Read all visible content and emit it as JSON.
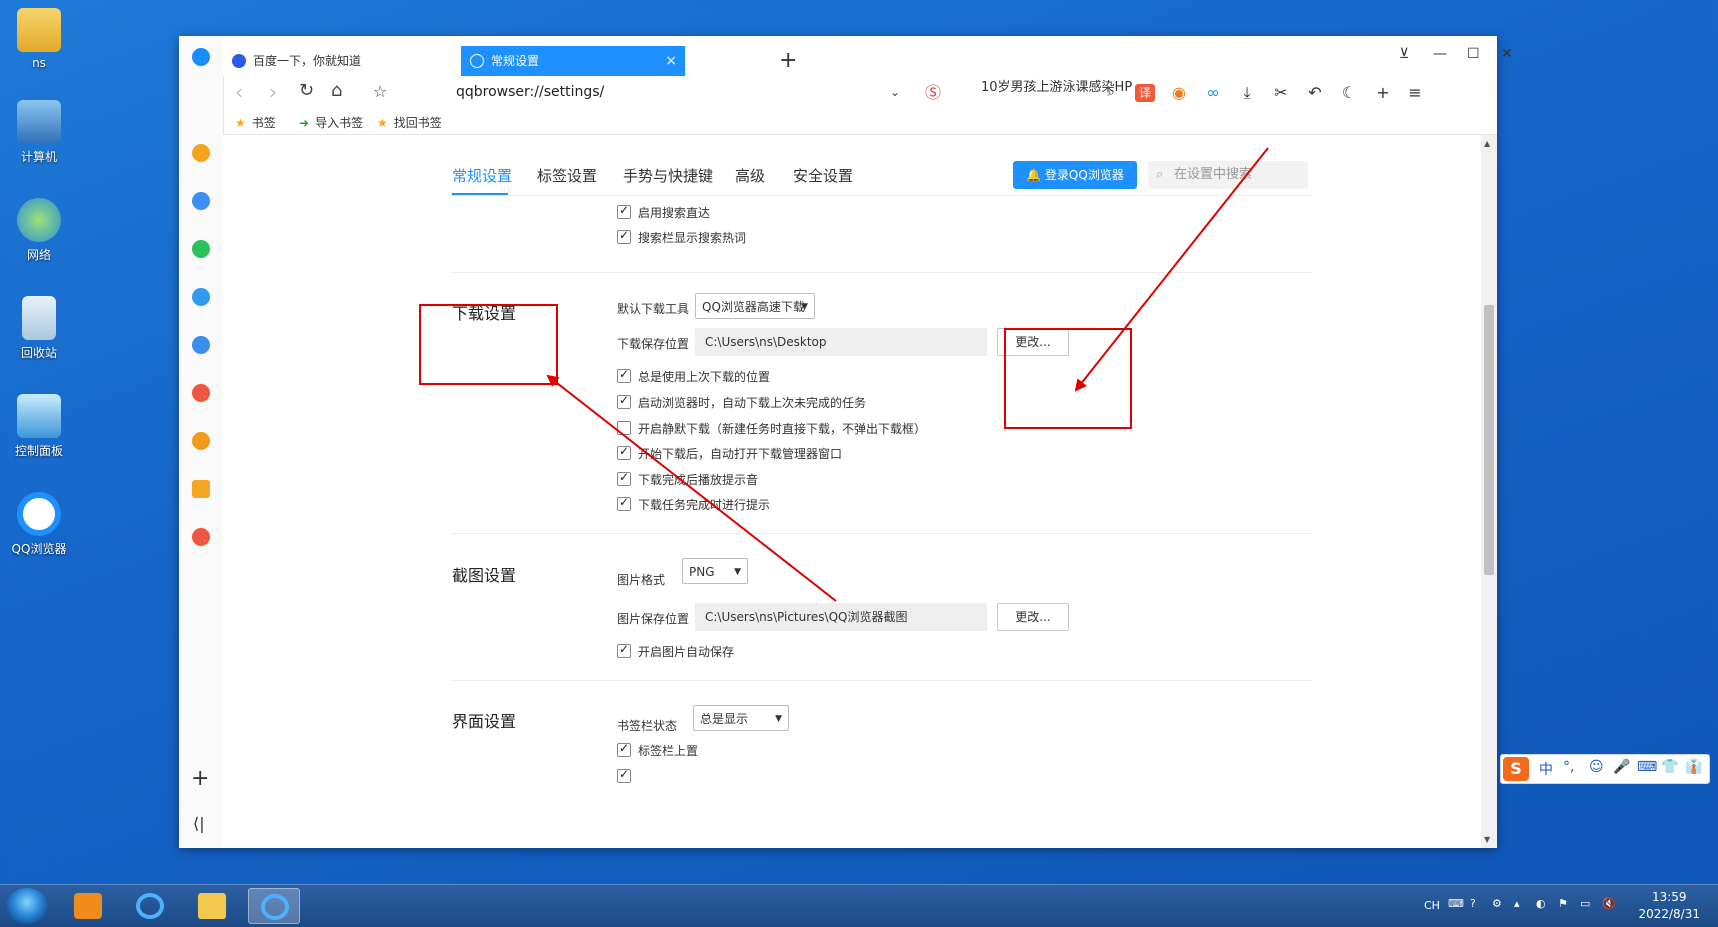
{
  "desktop": {
    "icons": [
      {
        "label": "ns",
        "color": "#f0c04a"
      },
      {
        "label": "计算机",
        "color": "#4b8fd6"
      },
      {
        "label": "网络",
        "color": "#3d9be0"
      },
      {
        "label": "回收站",
        "color": "#cfe3f2"
      },
      {
        "label": "控制面板",
        "color": "#5ab0e8"
      },
      {
        "label": "QQ浏览器",
        "color": "#1e90ff"
      }
    ]
  },
  "browser": {
    "tabs": [
      {
        "title": "百度一下，你就知道",
        "close": ""
      },
      {
        "title": "常规设置",
        "close": "×"
      }
    ],
    "new_tab": "+",
    "window_controls": {
      "pin": "⊻",
      "minimize": "—",
      "maximize": "☐",
      "close": "✕"
    },
    "address": "qqbrowser://settings/",
    "news_ticker": "10岁男孩上游泳课感染HP",
    "bookmarks": [
      {
        "label": "书签"
      },
      {
        "label": "导入书签"
      },
      {
        "label": "找回书签"
      }
    ],
    "sidebar_plus": "+",
    "sidebar_collapse": "⟨|"
  },
  "settings": {
    "tabs": [
      "常规设置",
      "标签设置",
      "手势与快捷键",
      "高级",
      "安全设置"
    ],
    "login_button": "登录QQ浏览器",
    "search_placeholder": "在设置中搜索",
    "search_section": {
      "options": [
        {
          "label": "启用搜索直达",
          "checked": true
        },
        {
          "label": "搜索栏显示搜索热词",
          "checked": true
        }
      ]
    },
    "download": {
      "title": "下载设置",
      "tool_label": "默认下载工具",
      "tool_value": "QQ浏览器高速下载",
      "path_label": "下载保存位置",
      "path_value": "C:\\Users\\ns\\Desktop",
      "change_button": "更改...",
      "options": [
        {
          "label": "总是使用上次下载的位置",
          "checked": true
        },
        {
          "label": "启动浏览器时，自动下载上次未完成的任务",
          "checked": true
        },
        {
          "label": "开启静默下载（新建任务时直接下载，不弹出下载框）",
          "checked": false
        },
        {
          "label": "开始下载后，自动打开下载管理器窗口",
          "checked": true
        },
        {
          "label": "下载完成后播放提示音",
          "checked": true
        },
        {
          "label": "下载任务完成时进行提示",
          "checked": true
        }
      ]
    },
    "screenshot": {
      "title": "截图设置",
      "format_label": "图片格式",
      "format_value": "PNG",
      "path_label": "图片保存位置",
      "path_value": "C:\\Users\\ns\\Pictures\\QQ浏览器截图",
      "change_button": "更改...",
      "options": [
        {
          "label": "开启图片自动保存",
          "checked": true
        }
      ]
    },
    "interface": {
      "title": "界面设置",
      "bookmark_bar_label": "书签栏状态",
      "bookmark_bar_value": "总是显示",
      "options": [
        {
          "label": "标签栏上置",
          "checked": true
        }
      ]
    }
  },
  "ime": {
    "logo": "S",
    "items": [
      "中",
      "°,",
      "☺",
      "🎤",
      "⌨",
      "👕",
      "👔"
    ]
  },
  "taskbar": {
    "lang": "CH",
    "time": "13:59",
    "date": "2022/8/31"
  },
  "colors": {
    "accent": "#1e90ff",
    "annotation": "#e00000"
  }
}
